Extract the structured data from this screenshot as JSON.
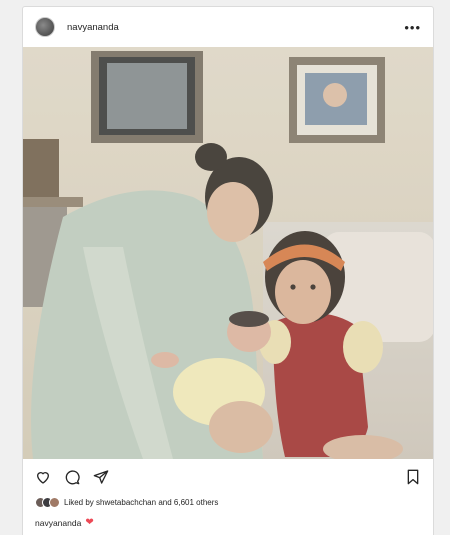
{
  "post": {
    "username": "navyananda",
    "more_glyph": "•••",
    "photo_alt": "",
    "likes_prefix": "Liked by",
    "liked_by_user": "shwetabachchan",
    "likes_and": "and",
    "likes_others": "6,601 others",
    "caption_user": "navyananda",
    "caption_emoji": "❤"
  },
  "icons": {
    "like": "heart-outline-icon",
    "comment": "comment-bubble-icon",
    "share": "paper-plane-icon",
    "save": "bookmark-icon",
    "more": "ellipsis-icon"
  },
  "colors": {
    "text": "#262626",
    "border": "#dbdbdb",
    "heart": "#ed4956"
  }
}
